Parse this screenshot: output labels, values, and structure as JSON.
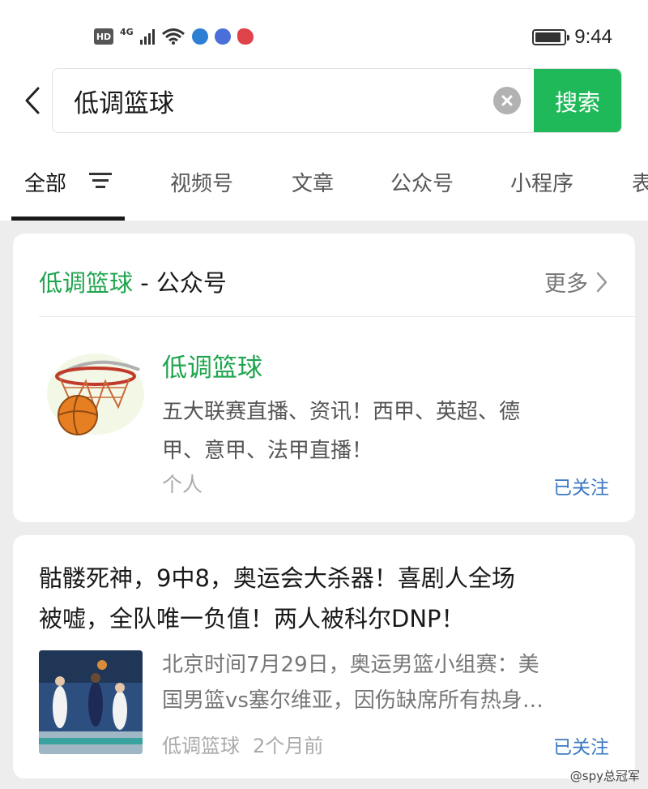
{
  "status_bar": {
    "hd": "HD",
    "network": "4G",
    "time": "9:44",
    "battery_level": 0.9
  },
  "search": {
    "query": "低调篮球",
    "button_label": "搜索",
    "clear_icon": "close-icon"
  },
  "tabs": [
    {
      "label": "全部",
      "active": true
    },
    {
      "label": "视频号"
    },
    {
      "label": "文章"
    },
    {
      "label": "公众号"
    },
    {
      "label": "小程序"
    },
    {
      "label": "表"
    }
  ],
  "account_section": {
    "keyword": "低调篮球",
    "separator": "-",
    "section_name": "公众号",
    "more_label": "更多",
    "account": {
      "name": "低调篮球",
      "desc_line1": "五大联赛直播、资讯！西甲、英超、德",
      "desc_line2": "甲、意甲、法甲直播！",
      "type": "个人",
      "follow_status": "已关注"
    }
  },
  "article": {
    "title_line1": "骷髅死神，9中8，奥运会大杀器！喜剧人全场",
    "title_line2": "被嘘，全队唯一负值！两人被科尔DNP！",
    "summary_line1": "北京时间7月29日，奥运男篮小组赛：美",
    "summary_line2": "国男篮vs塞尔维亚，因伤缺席所有热身…",
    "source": "低调篮球",
    "time_ago": "2个月前",
    "follow_status": "已关注"
  },
  "watermark": "@spy总冠军",
  "colors": {
    "accent_green": "#20b95a",
    "name_green": "#20a54f",
    "link_blue": "#3a78c2"
  }
}
